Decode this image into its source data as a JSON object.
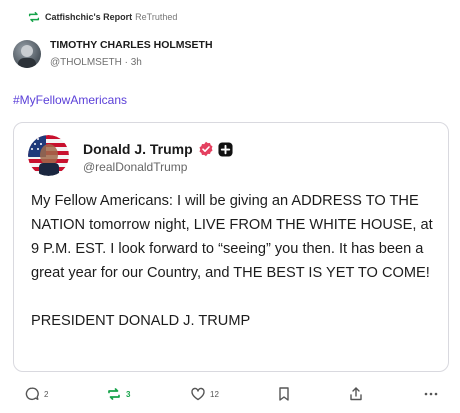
{
  "retruth": {
    "user": "Catfishchic's Report",
    "label": "ReTruthed"
  },
  "author": {
    "name": "TIMOTHY CHARLES HOLMSETH",
    "handle": "@THOLMSETH",
    "separator": "·",
    "time": "3h"
  },
  "hashtag": "#MyFellowAmericans",
  "quoted": {
    "name": "Donald J. Trump",
    "handle": "@realDonaldTrump",
    "paragraph1": "My Fellow Americans: I will be giving an ADDRESS TO THE NATION tomorrow night, LIVE FROM THE WHITE HOUSE, at 9 P.M. EST. I look forward to “seeing” you then. It has been a great year for our Country, and THE BEST IS YET TO COME!",
    "paragraph2": "PRESIDENT DONALD J. TRUMP"
  },
  "actions": {
    "replies": "2",
    "retruths": "3",
    "likes": "12"
  },
  "colors": {
    "hashtag": "#5a3fd8",
    "retruth_green": "#16a34a",
    "verified": "#e4405f",
    "border": "#d9d9df"
  },
  "icons": [
    "retruth-icon",
    "verified-icon",
    "plus-badge-icon",
    "reply-icon",
    "heart-icon",
    "bookmark-icon",
    "share-icon",
    "more-icon"
  ]
}
